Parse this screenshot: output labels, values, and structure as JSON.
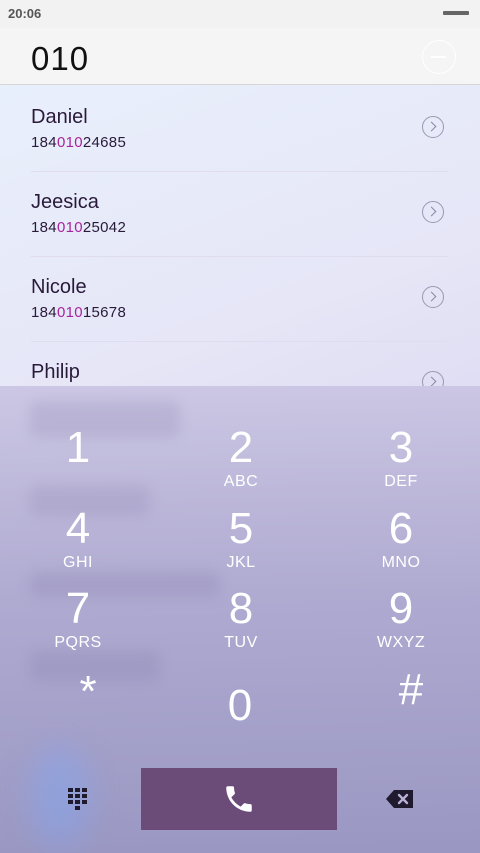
{
  "status": {
    "time": "20:06"
  },
  "dialer": {
    "input": "010"
  },
  "contacts": [
    {
      "name": "Daniel",
      "num_pre": "184",
      "num_match": "010",
      "num_post": "24685"
    },
    {
      "name": "Jeesica",
      "num_pre": "184",
      "num_match": "010",
      "num_post": "25042"
    },
    {
      "name": "Nicole",
      "num_pre": "184",
      "num_match": "010",
      "num_post": "15678"
    },
    {
      "name": "Philip",
      "num_pre": "",
      "num_match": "",
      "num_post": ""
    }
  ],
  "keypad": [
    {
      "digit": "1",
      "letters": ""
    },
    {
      "digit": "2",
      "letters": "ABC"
    },
    {
      "digit": "3",
      "letters": "DEF"
    },
    {
      "digit": "4",
      "letters": "GHI"
    },
    {
      "digit": "5",
      "letters": "JKL"
    },
    {
      "digit": "6",
      "letters": "MNO"
    },
    {
      "digit": "7",
      "letters": "PQRS"
    },
    {
      "digit": "8",
      "letters": "TUV"
    },
    {
      "digit": "9",
      "letters": "WXYZ"
    },
    {
      "digit": "*",
      "letters": ""
    },
    {
      "digit": "0",
      "letters": ""
    },
    {
      "digit": "#",
      "letters": ""
    }
  ],
  "colors": {
    "match_highlight": "#a8249e",
    "call_button": "#6b4c78"
  },
  "icons": {
    "clear": "minus-circle-icon",
    "call": "phone-icon",
    "dialpad": "dialpad-grid-icon",
    "delete": "backspace-icon"
  }
}
